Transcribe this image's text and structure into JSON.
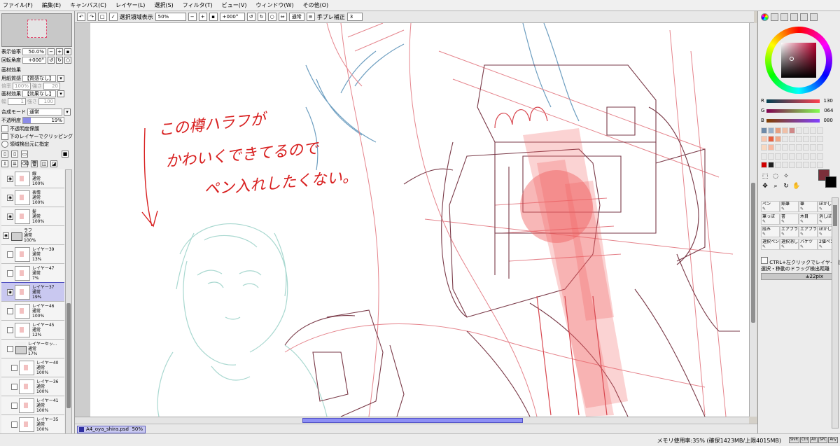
{
  "menu": [
    "ファイル(F)",
    "編集(E)",
    "キャンバス(C)",
    "レイヤー(L)",
    "選択(S)",
    "フィルタ(T)",
    "ビュー(V)",
    "ウィンドウ(W)",
    "その他(O)"
  ],
  "toolbar": {
    "selection_label": "選択領域表示",
    "zoom": "50%",
    "rotation": "+000°",
    "blend": "通常",
    "stabilizer_label": "手ブレ補正",
    "stabilizer_value": "3"
  },
  "navigator": {
    "zoom_label": "表示倍率",
    "zoom_value": "50.0%",
    "rotate_label": "回転角度",
    "rotate_value": "+000°"
  },
  "texture": {
    "section": "画材効果",
    "paper_label": "用紙質感",
    "paper_value": "【質感なし】",
    "paper_scale": "倍率",
    "paper_scale_value": "100%",
    "paper_strength": "強さ",
    "paper_strength_value": "20",
    "effect_label": "画材効果",
    "effect_value": "【効果なし】",
    "effect_width": "幅",
    "effect_width_value": "1",
    "effect_strength": "強さ",
    "effect_strength_value": "100"
  },
  "layer_props": {
    "blend_label": "合成モード",
    "blend_value": "通常",
    "opacity_label": "不透明度",
    "opacity_value": "19%",
    "protect": "不透明度保護",
    "clipping": "下のレイヤーでクリッピング",
    "source": "領域検出元に指定"
  },
  "layers": [
    {
      "name": "線",
      "mode": "通常",
      "opacity": "100%",
      "visible": true,
      "type": "layer",
      "indent": 1
    },
    {
      "name": "表情",
      "mode": "通常",
      "opacity": "100%",
      "visible": true,
      "type": "layer",
      "indent": 1
    },
    {
      "name": "髪",
      "mode": "通常",
      "opacity": "100%",
      "visible": true,
      "type": "layer",
      "indent": 1
    },
    {
      "name": "ラフ",
      "mode": "通常",
      "opacity": "100%",
      "visible": true,
      "type": "folder",
      "indent": 0
    },
    {
      "name": "レイヤー39",
      "mode": "通常",
      "opacity": "13%",
      "visible": false,
      "type": "layer",
      "indent": 1
    },
    {
      "name": "レイヤー47",
      "mode": "通常",
      "opacity": "7%",
      "visible": false,
      "type": "layer",
      "indent": 1
    },
    {
      "name": "レイヤー37",
      "mode": "通常",
      "opacity": "19%",
      "visible": true,
      "type": "layer",
      "indent": 1,
      "active": true
    },
    {
      "name": "レイヤー46",
      "mode": "通常",
      "opacity": "100%",
      "visible": false,
      "type": "layer",
      "indent": 1
    },
    {
      "name": "レイヤー45",
      "mode": "通常",
      "opacity": "12%",
      "visible": false,
      "type": "layer",
      "indent": 1
    },
    {
      "name": "レイヤーセッ...",
      "mode": "通常",
      "opacity": "17%",
      "visible": false,
      "type": "folder",
      "indent": 1
    },
    {
      "name": "レイヤー40",
      "mode": "通常",
      "opacity": "100%",
      "visible": false,
      "type": "layer",
      "indent": 2
    },
    {
      "name": "レイヤー36",
      "mode": "通常",
      "opacity": "100%",
      "visible": false,
      "type": "layer",
      "indent": 2
    },
    {
      "name": "レイヤー41",
      "mode": "通常",
      "opacity": "100%",
      "visible": false,
      "type": "layer",
      "indent": 2
    },
    {
      "name": "レイヤー35",
      "mode": "通常",
      "opacity": "100%",
      "visible": false,
      "type": "layer",
      "indent": 2
    }
  ],
  "canvas": {
    "annotation_line1": "この樽ハラフが",
    "annotation_line2": "かわいくできてるので",
    "annotation_line3": "ペン入れしたくない。"
  },
  "document": {
    "name": "A4_oya_shira.psd",
    "zoom": "50%"
  },
  "status": {
    "memory": "メモリ使用率:35% (確保1423MB/上限4015MB)",
    "keys": [
      "Shift",
      "Ctrl",
      "Alt",
      "SPC",
      "Any"
    ]
  },
  "color": {
    "r_label": "R",
    "r_value": "130",
    "g_label": "G",
    "g_value": "064",
    "b_label": "B",
    "b_value": "080",
    "fg": "#823f50",
    "bg": "#000000"
  },
  "brushes": [
    [
      "ペン",
      "鉛筆",
      "筆",
      "ぼかし筆"
    ],
    [
      "筆っぽ",
      "書",
      "木目",
      "消しぼ"
    ],
    [
      "段み",
      "エアブラシ",
      "エアブラシ",
      "ぼかし"
    ],
    [
      "選択ペン",
      "選択消し",
      "バケツ",
      "2値ペン"
    ]
  ],
  "tool_options": {
    "ctrl_click": "CTRL+左クリックでレイヤー選択",
    "drag_label": "選択・移動のドラッグ検出距離",
    "drag_value": "±22pix"
  }
}
